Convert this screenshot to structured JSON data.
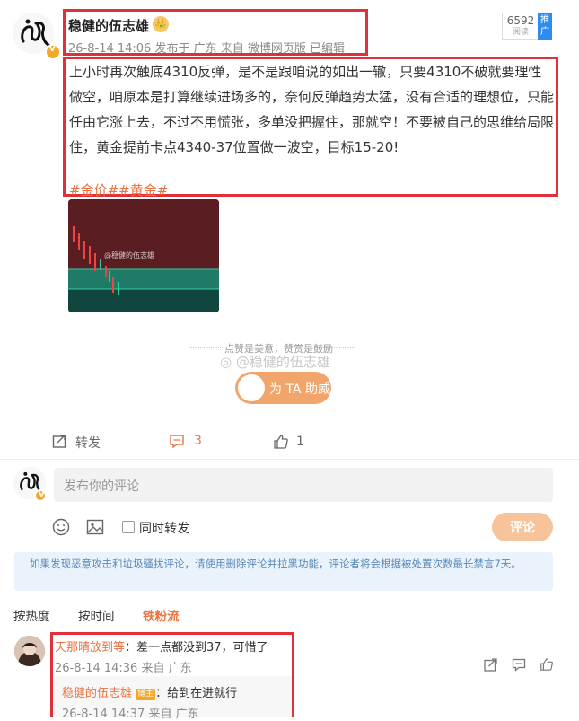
{
  "post": {
    "author": "稳健的伍志雄",
    "meta_time": "26-8-14 14:06",
    "meta_from": "发布于 广东",
    "meta_client": "来自 微博网页版",
    "meta_edit": "已编辑",
    "read_count": "6592",
    "read_label": "阅读",
    "promote_label": "推广",
    "text_lines": [
      "上小时再次触底4310反弹，是不是跟咱说的如出一辙，只要4310不破就要理性",
      "做空，咱原本是打算继续进场多的，奈何反弹趋势太猛，没有合适的理想位，只能",
      "任由它涨上去，不过不用慌张，多单没把握住，那就空！不要被自己的思维给局限",
      "住，黄金提前卡点4340-37位置做一波空，目标15-20!"
    ],
    "tags": [
      "#金价#",
      "#黄金#"
    ],
    "image_watermark": "@稳健的伍志雄"
  },
  "support": {
    "divider_text": "点赞是美意，赞赏是鼓励",
    "watermark_text": "@稳健的伍志雄",
    "button_label": "为 TA 助威"
  },
  "actions": {
    "repost_label": "转发",
    "comment_count": "3",
    "like_count": "1"
  },
  "composer": {
    "placeholder": "发布你的评论",
    "repost_checkbox_label": "同时转发",
    "submit_label": "评论"
  },
  "notice": {
    "text": "如果发现恶意攻击和垃圾骚扰评论，请使用删除评论并拉黑功能，评论者将会根据被处置次数最长禁言7天。"
  },
  "sort_tabs": [
    "按热度",
    "按时间",
    "铁粉流"
  ],
  "comments": [
    {
      "author": "天那晴放到等",
      "text": "：差一点都没到37，可惜了",
      "time": "26-8-14 14:36",
      "location": "来自 广东",
      "reply": {
        "author": "稳健的伍志雄",
        "badge": "博主",
        "text": "：给到在进就行",
        "time": "26-8-14 14:37",
        "location": "来自 广东"
      }
    }
  ],
  "colors": {
    "accent": "#eb7340",
    "highlight": "#e0303a",
    "notice_bg": "#eaf3fb",
    "button": "#f2a56a"
  }
}
